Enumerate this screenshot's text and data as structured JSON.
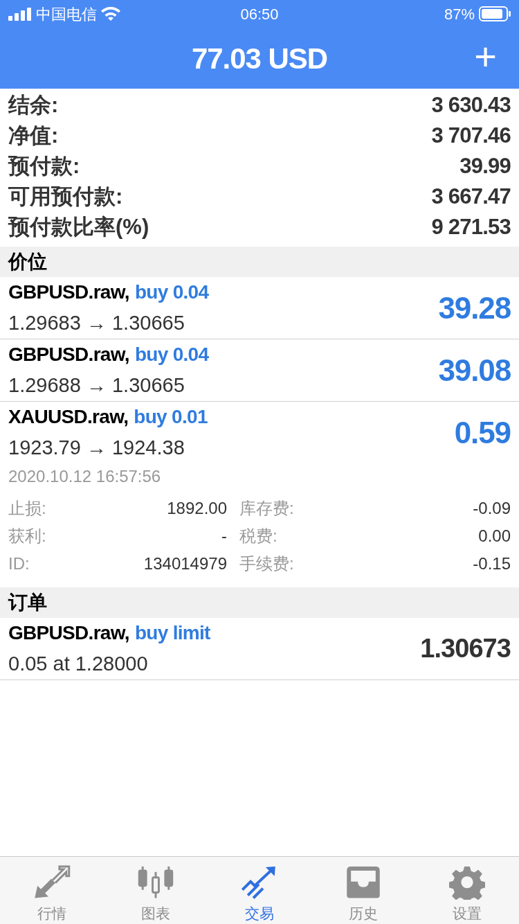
{
  "status_bar": {
    "carrier": "中国电信",
    "time": "06:50",
    "battery": "87%"
  },
  "header": {
    "title": "77.03 USD",
    "action": "+"
  },
  "summary": [
    {
      "label": "结余:",
      "value": "3 630.43"
    },
    {
      "label": "净值:",
      "value": "3 707.46"
    },
    {
      "label": "预付款:",
      "value": "39.99"
    },
    {
      "label": "可用预付款:",
      "value": "3 667.47"
    },
    {
      "label": "预付款比率(%)",
      "value": "9 271.53"
    }
  ],
  "positions": {
    "title": "价位",
    "items": [
      {
        "symbol": "GBPUSD.raw,",
        "side": "buy 0.04",
        "prices": "1.29683 → 1.30665",
        "profit": "39.28",
        "expanded": false
      },
      {
        "symbol": "GBPUSD.raw,",
        "side": "buy 0.04",
        "prices": "1.29688 → 1.30665",
        "profit": "39.08",
        "expanded": false
      },
      {
        "symbol": "XAUUSD.raw,",
        "side": "buy 0.01",
        "prices": "1923.79 → 1924.38",
        "profit": "0.59",
        "expanded": true,
        "details": {
          "time": "2020.10.12 16:57:56",
          "rows": [
            {
              "label": "止损:",
              "value": "1892.00",
              "label2": "库存费:",
              "value2": "-0.09"
            },
            {
              "label": "获利:",
              "value": "-",
              "label2": "税费:",
              "value2": "0.00"
            },
            {
              "label": "ID:",
              "value": "134014979",
              "label2": "手续费:",
              "value2": "-0.15"
            }
          ]
        }
      }
    ]
  },
  "orders": {
    "title": "订单",
    "items": [
      {
        "symbol": "GBPUSD.raw,",
        "side": "buy limit",
        "prices": "0.05 at 1.28000",
        "price": "1.30673"
      }
    ]
  },
  "tab_bar": [
    {
      "kind": "quotes",
      "label": "行情",
      "selected": false
    },
    {
      "kind": "chart",
      "label": "图表",
      "selected": false
    },
    {
      "kind": "trade",
      "label": "交易",
      "selected": true
    },
    {
      "kind": "history",
      "label": "历史",
      "selected": false
    },
    {
      "kind": "settings",
      "label": "设置",
      "selected": false
    }
  ]
}
